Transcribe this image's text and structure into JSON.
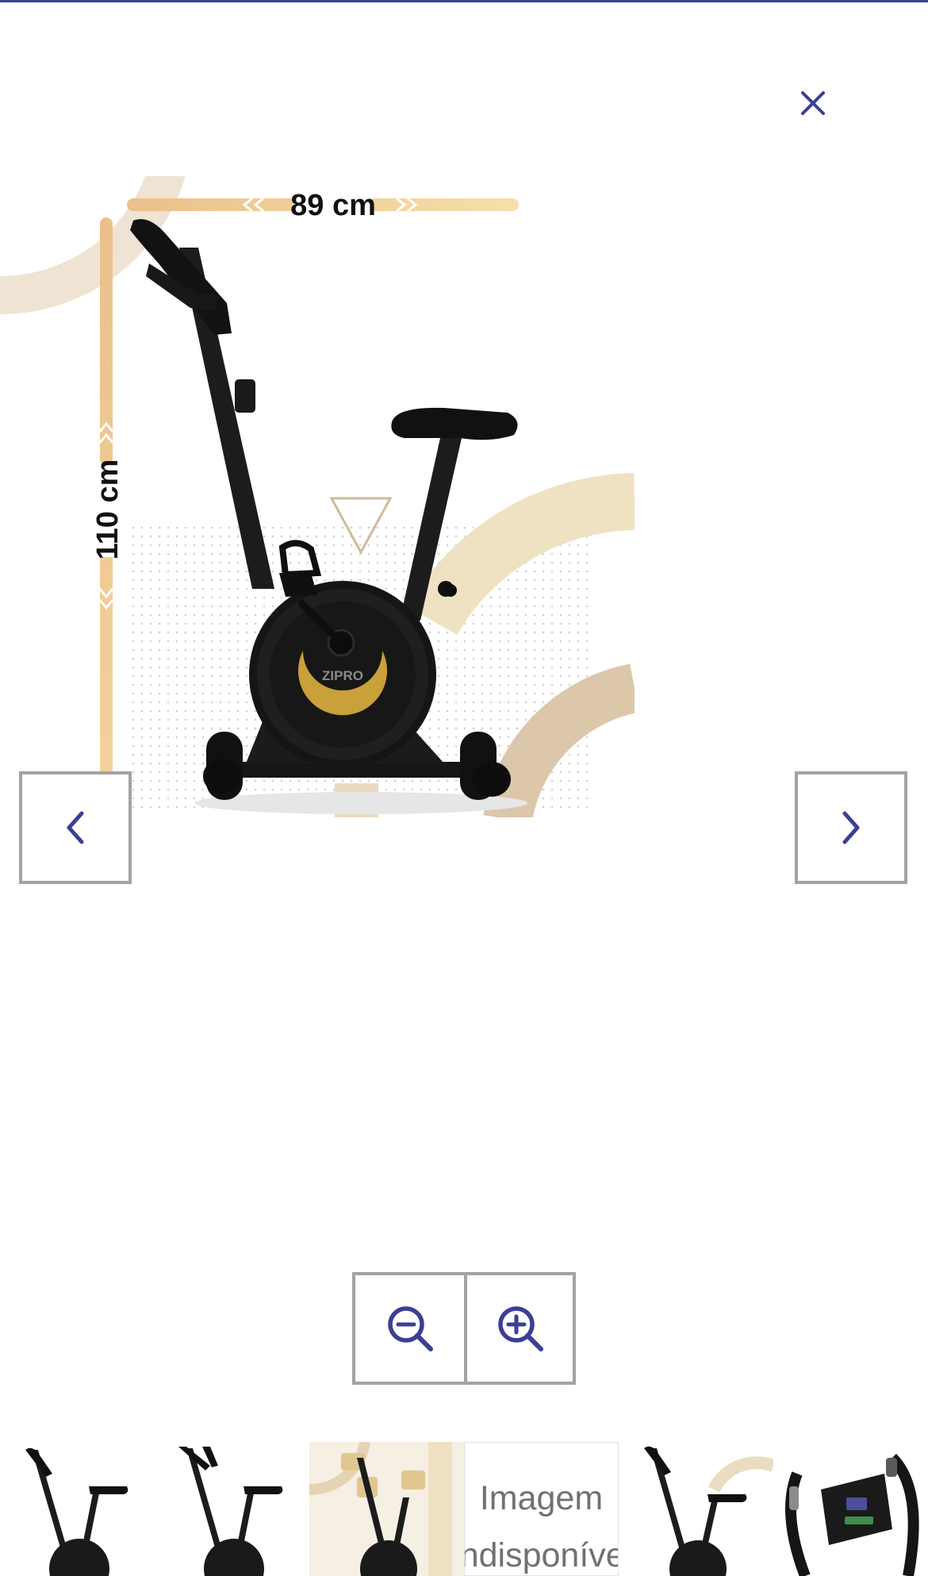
{
  "viewer": {
    "close_icon": "close-icon",
    "image": {
      "brand_logo_text": "ZIPRO",
      "width_dimension": "89 cm",
      "height_dimension": "110 cm"
    },
    "prev_icon": "chevron-left-icon",
    "next_icon": "chevron-right-icon"
  },
  "zoom": {
    "zoom_out_icon": "zoom-out-icon",
    "zoom_in_icon": "zoom-in-icon"
  },
  "thumbnails": {
    "unavailable_line1": "Imagem",
    "unavailable_line2": "Indisponível"
  },
  "colors": {
    "accent": "#3b3f96",
    "button_border": "#a3a3a3",
    "gold": "#c9a03a",
    "beige": "#e9d5b5"
  }
}
